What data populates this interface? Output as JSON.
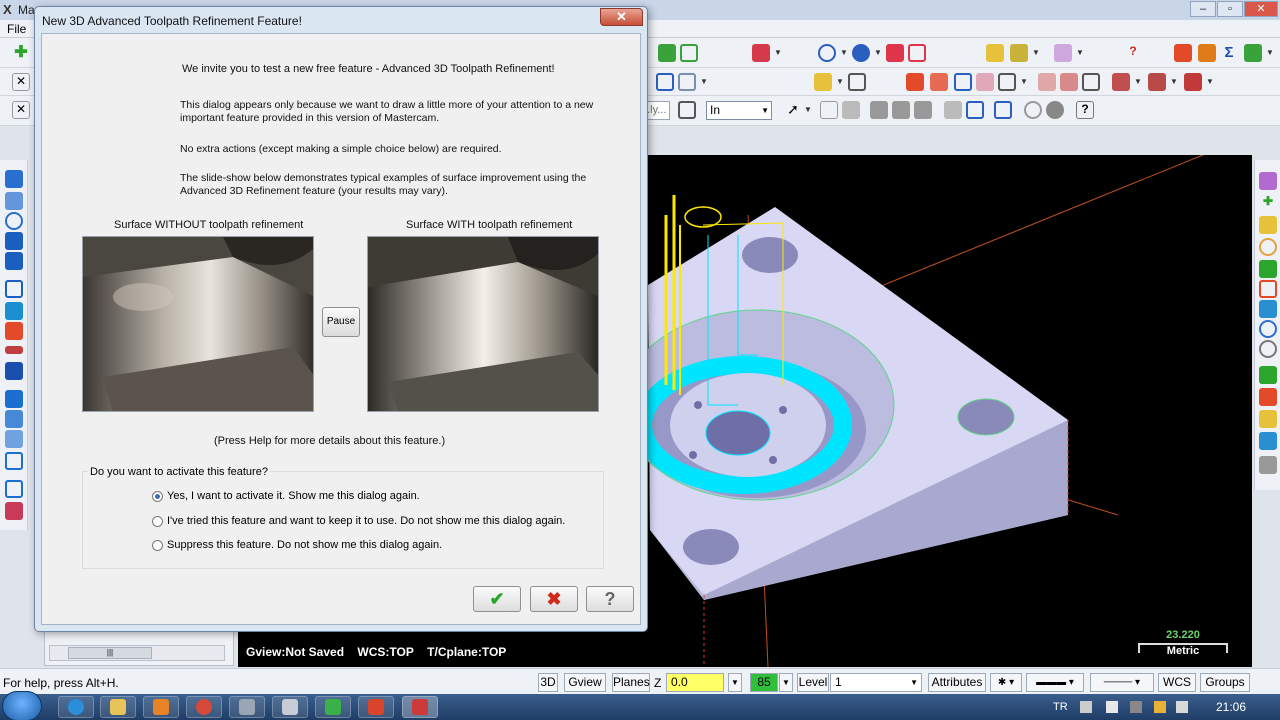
{
  "app": {
    "title": "Ma",
    "logo_letter": "X",
    "menu_first": "File"
  },
  "toolbar": {
    "unit_select": "In",
    "left_input_stub": "...ly..."
  },
  "viewport": {
    "status": {
      "gview": "Gview:Not Saved",
      "wcs": "WCS:TOP",
      "tcplane": "T/Cplane:TOP"
    },
    "scale": {
      "value": "23.220",
      "unit": "Metric"
    }
  },
  "statusbar": {
    "help_text": "For help, press Alt+H.",
    "btn_3d": "3D",
    "btn_gview": "Gview",
    "btn_planes": "Planes",
    "z_label": "Z",
    "z_value": "0.0",
    "color_value": "85",
    "level_label": "Level",
    "level_value": "1",
    "btn_attributes": "Attributes",
    "btn_wcs": "WCS",
    "btn_groups": "Groups"
  },
  "taskbar": {
    "language": "TR",
    "clock": "21:06"
  },
  "dialog": {
    "title": "New 3D Advanced Toolpath Refinement Feature!",
    "close_label": "✕",
    "intro": "We invite you to test a new free feature - Advanced 3D Toolpath Refinement!",
    "paragraph_1": "This dialog appears only because we want to draw a little more of your attention to a new important feature provided in this version of Mastercam.",
    "paragraph_2": "No extra actions (except making a simple choice below) are required.",
    "paragraph_3": "The slide-show below demonstrates typical examples of surface improvement using the Advanced 3D Refinement feature (your results may vary).",
    "caption_without": "Surface WITHOUT toolpath refinement",
    "caption_with": "Surface WITH toolpath refinement",
    "pause_label": "Pause",
    "help_note": "(Press Help for more details about this feature.)",
    "question": "Do you want to activate this feature?",
    "options": [
      {
        "label": "Yes, I want to activate it. Show me this dialog again.",
        "checked": true
      },
      {
        "label": "I've tried this feature and want to keep it to use. Do not show me this dialog again.",
        "checked": false
      },
      {
        "label": "Suppress this feature. Do not show me this dialog again.",
        "checked": false
      }
    ],
    "ok_label": "✔",
    "cancel_label": "✖",
    "help_label": "?"
  },
  "colors": {
    "viewport_bg": "#000000",
    "part_face": "#d8d8f4",
    "part_side": "#b9b9dc",
    "toolpath_cyan": "#00e5ff",
    "toolpath_yellow": "#ffe800",
    "axis_line": "#c0501f",
    "accent_ok": "#2ca52c",
    "accent_cancel": "#d12a1a"
  }
}
